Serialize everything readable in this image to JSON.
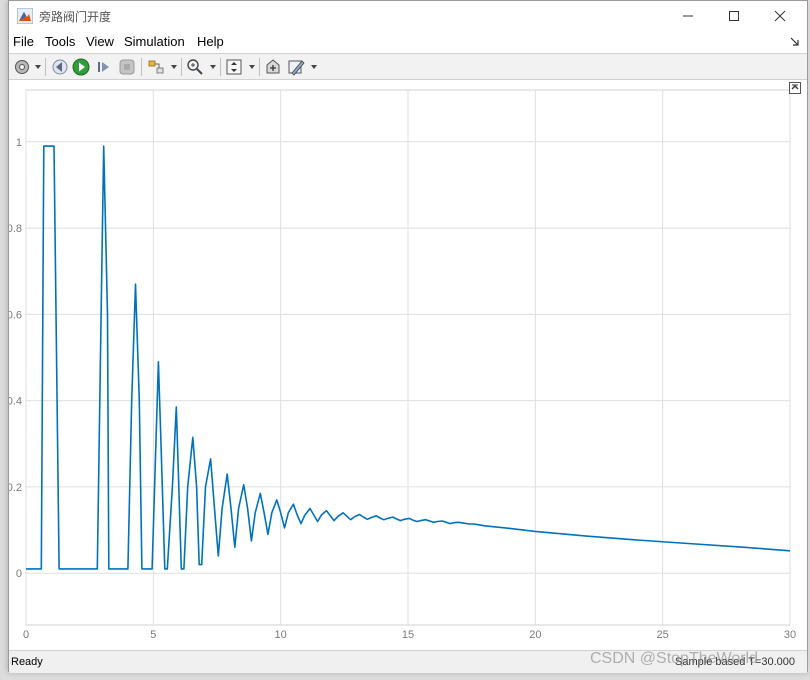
{
  "window": {
    "title": "旁路阀门开度"
  },
  "menu": [
    "File",
    "Tools",
    "View",
    "Simulation",
    "Help"
  ],
  "toolbar": {
    "icons": [
      "gear-icon",
      "step-back-icon",
      "run-icon",
      "step-forward-icon",
      "stop-icon",
      "highlight-icon",
      "zoom-icon",
      "fit-icon",
      "restore-icon",
      "style-icon"
    ]
  },
  "status": {
    "left": "Ready",
    "right": "Sample based  T=30.000"
  },
  "watermark": "CSDN @StopTheWorld",
  "colors": {
    "line": "#0072BD",
    "grid": "#dfdfdf",
    "axis": "#d0d0d0",
    "ticks": "#7a7a7a"
  },
  "chart_data": {
    "type": "line",
    "title": "",
    "xlabel": "",
    "ylabel": "",
    "xlim": [
      0,
      30
    ],
    "ylim": [
      -0.12,
      1.12
    ],
    "xticks": [
      0,
      5,
      10,
      15,
      20,
      25,
      30
    ],
    "yticks": [
      0,
      0.2,
      0.4,
      0.6,
      0.8,
      1
    ],
    "grid": true,
    "series": [
      {
        "name": "",
        "x": [
          0,
          0.6,
          0.7,
          1.0,
          1.1,
          1.3,
          2.8,
          2.95,
          3.05,
          3.2,
          3.25,
          4.0,
          4.15,
          4.3,
          4.45,
          4.55,
          4.95,
          5.1,
          5.2,
          5.3,
          5.45,
          5.55,
          5.75,
          5.9,
          6.0,
          6.1,
          6.2,
          6.35,
          6.55,
          6.7,
          6.8,
          6.9,
          7.05,
          7.25,
          7.4,
          7.55,
          7.7,
          7.9,
          8.05,
          8.2,
          8.35,
          8.55,
          8.7,
          8.85,
          9.0,
          9.2,
          9.35,
          9.5,
          9.65,
          9.85,
          10.0,
          10.15,
          10.3,
          10.5,
          10.65,
          10.8,
          10.95,
          11.15,
          11.3,
          11.45,
          11.6,
          11.8,
          11.95,
          12.1,
          12.25,
          12.45,
          12.6,
          12.75,
          12.9,
          13.1,
          13.25,
          13.4,
          13.55,
          13.75,
          13.9,
          14.05,
          14.2,
          14.4,
          14.55,
          14.7,
          14.85,
          15.05,
          15.2,
          15.35,
          15.5,
          15.7,
          15.85,
          16.0,
          16.15,
          16.35,
          16.5,
          16.65,
          16.8,
          17.0,
          17.2,
          17.4,
          17.6,
          17.8,
          18.0,
          19.0,
          20.0,
          22.0,
          24.0,
          26.0,
          28.0,
          30.0
        ],
        "values": [
          0.01,
          0.01,
          0.99,
          0.99,
          0.99,
          0.01,
          0.01,
          0.6,
          0.99,
          0.6,
          0.01,
          0.01,
          0.4,
          0.67,
          0.4,
          0.01,
          0.01,
          0.3,
          0.49,
          0.3,
          0.01,
          0.01,
          0.2,
          0.385,
          0.2,
          0.01,
          0.01,
          0.2,
          0.315,
          0.2,
          0.02,
          0.02,
          0.2,
          0.265,
          0.15,
          0.04,
          0.15,
          0.23,
          0.15,
          0.06,
          0.15,
          0.205,
          0.15,
          0.075,
          0.14,
          0.185,
          0.14,
          0.09,
          0.14,
          0.17,
          0.14,
          0.105,
          0.14,
          0.16,
          0.135,
          0.115,
          0.135,
          0.15,
          0.135,
          0.12,
          0.135,
          0.145,
          0.133,
          0.122,
          0.132,
          0.14,
          0.132,
          0.124,
          0.131,
          0.136,
          0.13,
          0.125,
          0.129,
          0.133,
          0.128,
          0.124,
          0.127,
          0.13,
          0.126,
          0.122,
          0.125,
          0.127,
          0.123,
          0.12,
          0.122,
          0.124,
          0.121,
          0.118,
          0.12,
          0.121,
          0.118,
          0.115,
          0.117,
          0.118,
          0.116,
          0.114,
          0.114,
          0.112,
          0.11,
          0.104,
          0.097,
          0.086,
          0.077,
          0.069,
          0.061,
          0.052
        ]
      }
    ]
  }
}
